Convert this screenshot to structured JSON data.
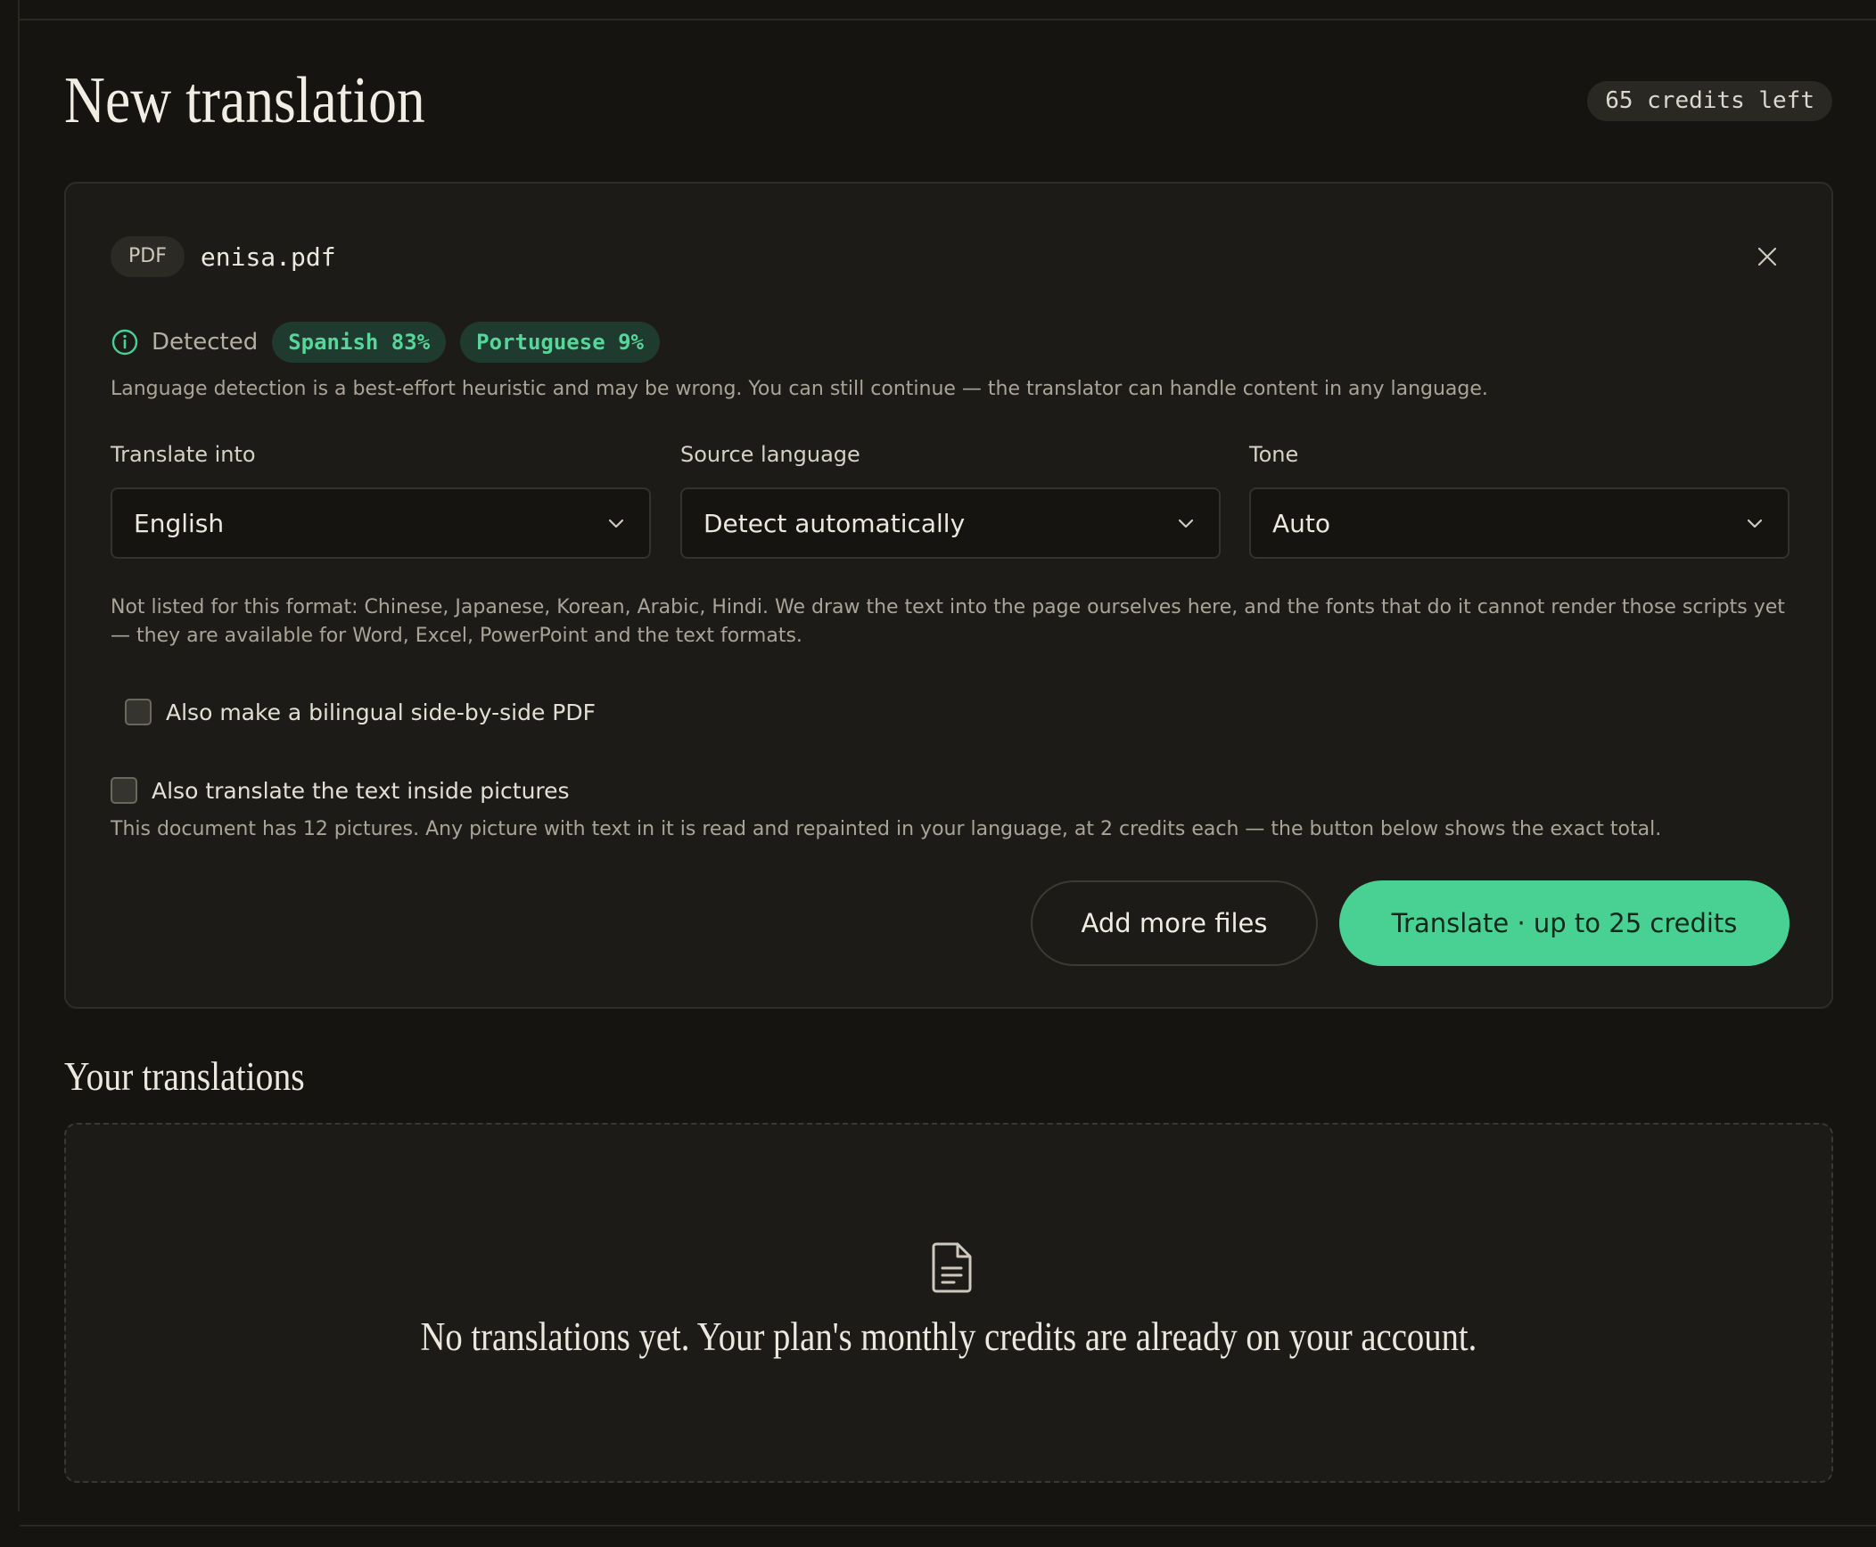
{
  "page": {
    "title": "New translation",
    "credits_left": "65 credits left"
  },
  "upload": {
    "file_type": "PDF",
    "file_name": "enisa.pdf",
    "detected_label": "Detected",
    "detected_languages": [
      "Spanish 83%",
      "Portuguese 9%"
    ],
    "detection_note": "Language detection is a best-effort heuristic and may be wrong. You can still continue — the translator can handle content in any language."
  },
  "fields": {
    "translate_into": {
      "label": "Translate into",
      "value": "English"
    },
    "source_language": {
      "label": "Source language",
      "value": "Detect automatically"
    },
    "tone": {
      "label": "Tone",
      "value": "Auto"
    }
  },
  "format_note": "Not listed for this format: Chinese, Japanese, Korean, Arabic, Hindi. We draw the text into the page ourselves here, and the fonts that do it cannot render those scripts yet — they are available for Word, Excel, PowerPoint and the text formats.",
  "options": {
    "bilingual": {
      "label": "Also make a bilingual side-by-side PDF",
      "checked": false
    },
    "pictures": {
      "label": "Also translate the text inside pictures",
      "checked": false
    },
    "pictures_note": "This document has 12 pictures. Any picture with text in it is read and repainted in your language, at 2 credits each — the button below shows the exact total."
  },
  "actions": {
    "add_more": "Add more files",
    "translate": "Translate · up to 25 credits"
  },
  "history": {
    "title": "Your translations",
    "empty_text": "No translations yet. Your plan's monthly credits are already on your account."
  },
  "icons": {
    "close": "close-icon",
    "info": "info-icon",
    "chevron": "chevron-down-icon",
    "document": "document-icon"
  },
  "colors": {
    "background": "#151411",
    "card": "#1c1b17",
    "accent": "#49d193",
    "chip_bg": "#1f3a2e",
    "chip_text": "#57d69a"
  }
}
